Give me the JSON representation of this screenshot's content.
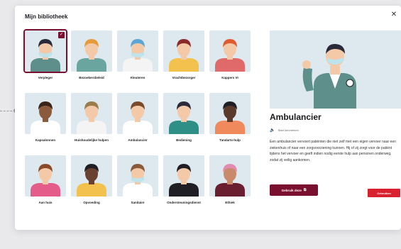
{
  "modal": {
    "title": "Mijn bibliotheek",
    "close_icon": "close-icon"
  },
  "tiles": [
    {
      "label": "Verpleger",
      "selected": true,
      "skin": "#f3c9a8",
      "hair": "#2a2a3a",
      "shirt": "#5e8f8a",
      "mask": "#bfe3ea"
    },
    {
      "label": "Bezoekersbeleid",
      "skin": "#f3c9a8",
      "hair": "#e59b3a",
      "shirt": "#6aa5a0",
      "mask": ""
    },
    {
      "label": "Kleuteren",
      "skin": "#f3c9a8",
      "hair": "#5ba6d6",
      "shirt": "#f4f4f4",
      "mask": "#bfe3ea"
    },
    {
      "label": "Vrachtbezorger",
      "skin": "#f3c9a8",
      "hair": "#8a2a2a",
      "shirt": "#f2c14e",
      "mask": ""
    },
    {
      "label": "Kappers VI",
      "skin": "#f3c9a8",
      "hair": "#e05a2f",
      "shirt": "#e06a6a",
      "mask": ""
    },
    {
      "label": "Kapsalonnen",
      "skin": "#8b5a3c",
      "hair": "#3a2418",
      "shirt": "#ffffff",
      "mask": ""
    },
    {
      "label": "Huishoudelijke hulpen",
      "skin": "#f3c9a8",
      "hair": "#9c7b4a",
      "shirt": "#f4f4f4",
      "mask": ""
    },
    {
      "label": "Ambulancier",
      "skin": "#f3c9a8",
      "hair": "#7a4a2a",
      "shirt": "#ffffff",
      "mask": ""
    },
    {
      "label": "Bediening",
      "skin": "#f3c9a8",
      "hair": "#2a2a3a",
      "shirt": "#2e8f87",
      "mask": ""
    },
    {
      "label": "Tandarts-hulp",
      "skin": "#5a3a2a",
      "hair": "#1e1e24",
      "shirt": "#f08a5d",
      "mask": ""
    },
    {
      "label": "Aan huis",
      "skin": "#f3c9a8",
      "hair": "#8a4a2a",
      "shirt": "#e45c8a",
      "mask": ""
    },
    {
      "label": "Opvoeding",
      "skin": "#6a4030",
      "hair": "#1e1e24",
      "shirt": "#f2c14e",
      "mask": ""
    },
    {
      "label": "Sanitaire",
      "skin": "#f3c9a8",
      "hair": "#8a5a3a",
      "shirt": "#ffffff",
      "mask": "#bfe3ea"
    },
    {
      "label": "Ondersteuningsdienst",
      "skin": "#f3c9a8",
      "hair": "#1e1e24",
      "shirt": "#1e1e24",
      "mask": ""
    },
    {
      "label": "Ethiek",
      "skin": "#c9896a",
      "hair": "#e38bb0",
      "shirt": "#6a1e30",
      "mask": ""
    }
  ],
  "detail": {
    "title": "Ambulancier",
    "subtitle": "Start kenmerken",
    "description": "Een ambulancier vervoert patiënten die niet zelf met een eigen vervoer naar een ziekenhuis of naar een zorgvoorziening kunnen. Hij of zij zorgt voor de patiënt tijdens het vervoer en geeft indien nodig eerste hulp aan personen onderweg, zodat zij veilig aankomen.",
    "use_button": "Gebruik deze",
    "use_icon": "external-link-icon",
    "side_tag": "Gebruiken",
    "sound_icon": "speaker-icon"
  },
  "colors": {
    "accent": "#7a1030",
    "tag": "#d8202e",
    "tile_bg": "#dde9ef"
  }
}
